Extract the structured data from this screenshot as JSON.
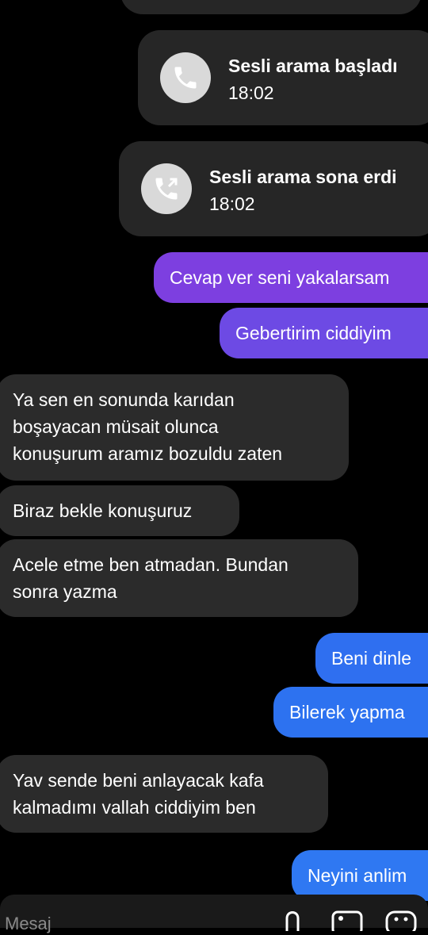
{
  "colors": {
    "received_bg": "#2b2b2b",
    "sent_gradient_top": "#7c3fe0",
    "sent_gradient_bottom": "#2f74f0",
    "call_card_bg": "#262626",
    "background": "#000000"
  },
  "calls": [
    {
      "title": "Sesli arama başladı",
      "time": "18:02",
      "icon": "phone-icon"
    },
    {
      "title": "Sesli arama sona erdi",
      "time": "18:02",
      "icon": "phone-outgoing-icon"
    }
  ],
  "messages": [
    {
      "from": "me",
      "text": "Cevap ver seni yakalarsam"
    },
    {
      "from": "me",
      "text": "Gebertirim ciddiyim"
    },
    {
      "from": "them",
      "lines": [
        "Ya sen en sonunda karıdan",
        "boşayacan müsait olunca",
        "konuşurum aramız bozuldu zaten"
      ]
    },
    {
      "from": "them",
      "lines": [
        "Biraz bekle konuşuruz"
      ]
    },
    {
      "from": "them",
      "lines": [
        "Acele etme ben atmadan. Bundan",
        "sonra yazma"
      ]
    },
    {
      "from": "me",
      "text": "Beni dinle"
    },
    {
      "from": "me",
      "text": "Bilerek yapma"
    },
    {
      "from": "them",
      "lines": [
        "Yav sende beni anlayacak kafa",
        "kalmadımı vallah ciddiyim ben"
      ]
    },
    {
      "from": "me",
      "text": "Neyini anlim"
    }
  ],
  "composer": {
    "placeholder": "Mesaj",
    "icons": [
      "microphone-icon",
      "image-icon",
      "sticker-icon"
    ]
  }
}
